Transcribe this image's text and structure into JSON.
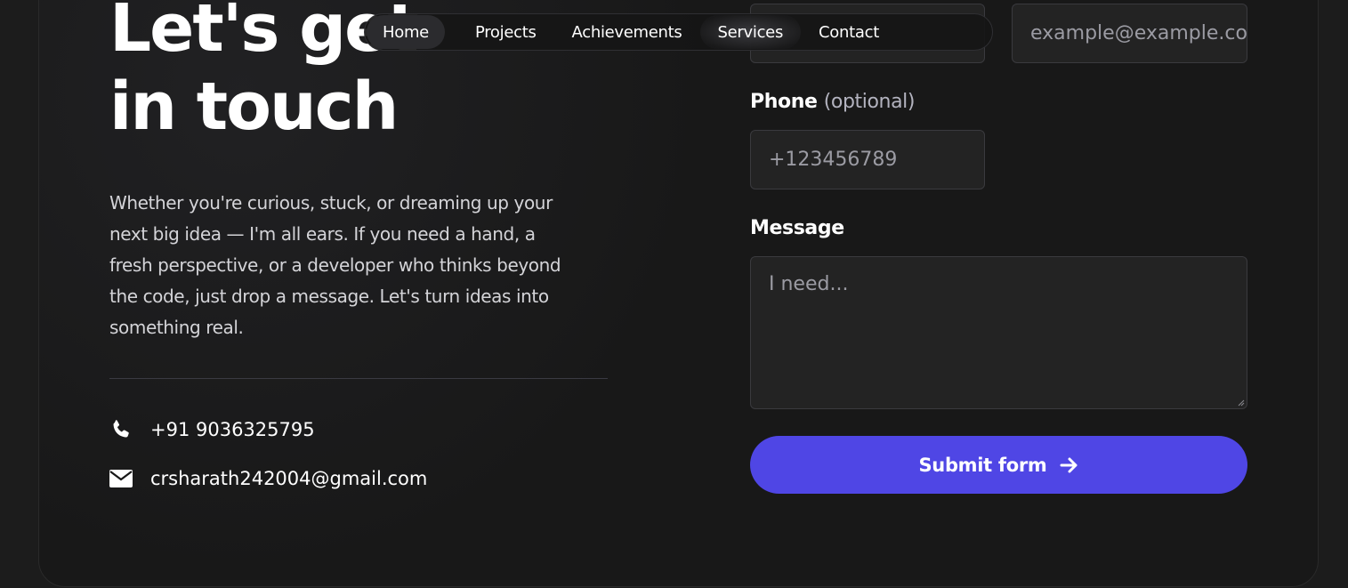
{
  "nav": {
    "items": [
      {
        "label": "Home",
        "active": true
      },
      {
        "label": "Projects"
      },
      {
        "label": "Achievements"
      },
      {
        "label": "Services"
      },
      {
        "label": "Contact"
      }
    ]
  },
  "hero": {
    "headline_line1": "Let's get",
    "headline_line2": "in touch",
    "intro": "Whether you're curious, stuck, or dreaming up your next big idea — I'm all ears. If you need a hand, a fresh perspective, or a developer who thinks beyond the code, just drop a message. Let's turn ideas into something real."
  },
  "contact": {
    "phone": "+91 9036325795",
    "email": "crsharath242004@gmail.com",
    "phone_icon": "phone-icon",
    "email_icon": "envelope-icon"
  },
  "form": {
    "name_placeholder": "",
    "email_placeholder": "example@example.com",
    "phone_label": "Phone",
    "phone_optional": "(optional)",
    "phone_placeholder": "+123456789",
    "message_label": "Message",
    "message_placeholder": "I need...",
    "submit_label": "Submit form",
    "submit_icon": "arrow-right-icon"
  },
  "colors": {
    "background": "#181818",
    "accent": "#4f46e5",
    "text": "#ffffff",
    "muted": "#9b9ba3"
  }
}
